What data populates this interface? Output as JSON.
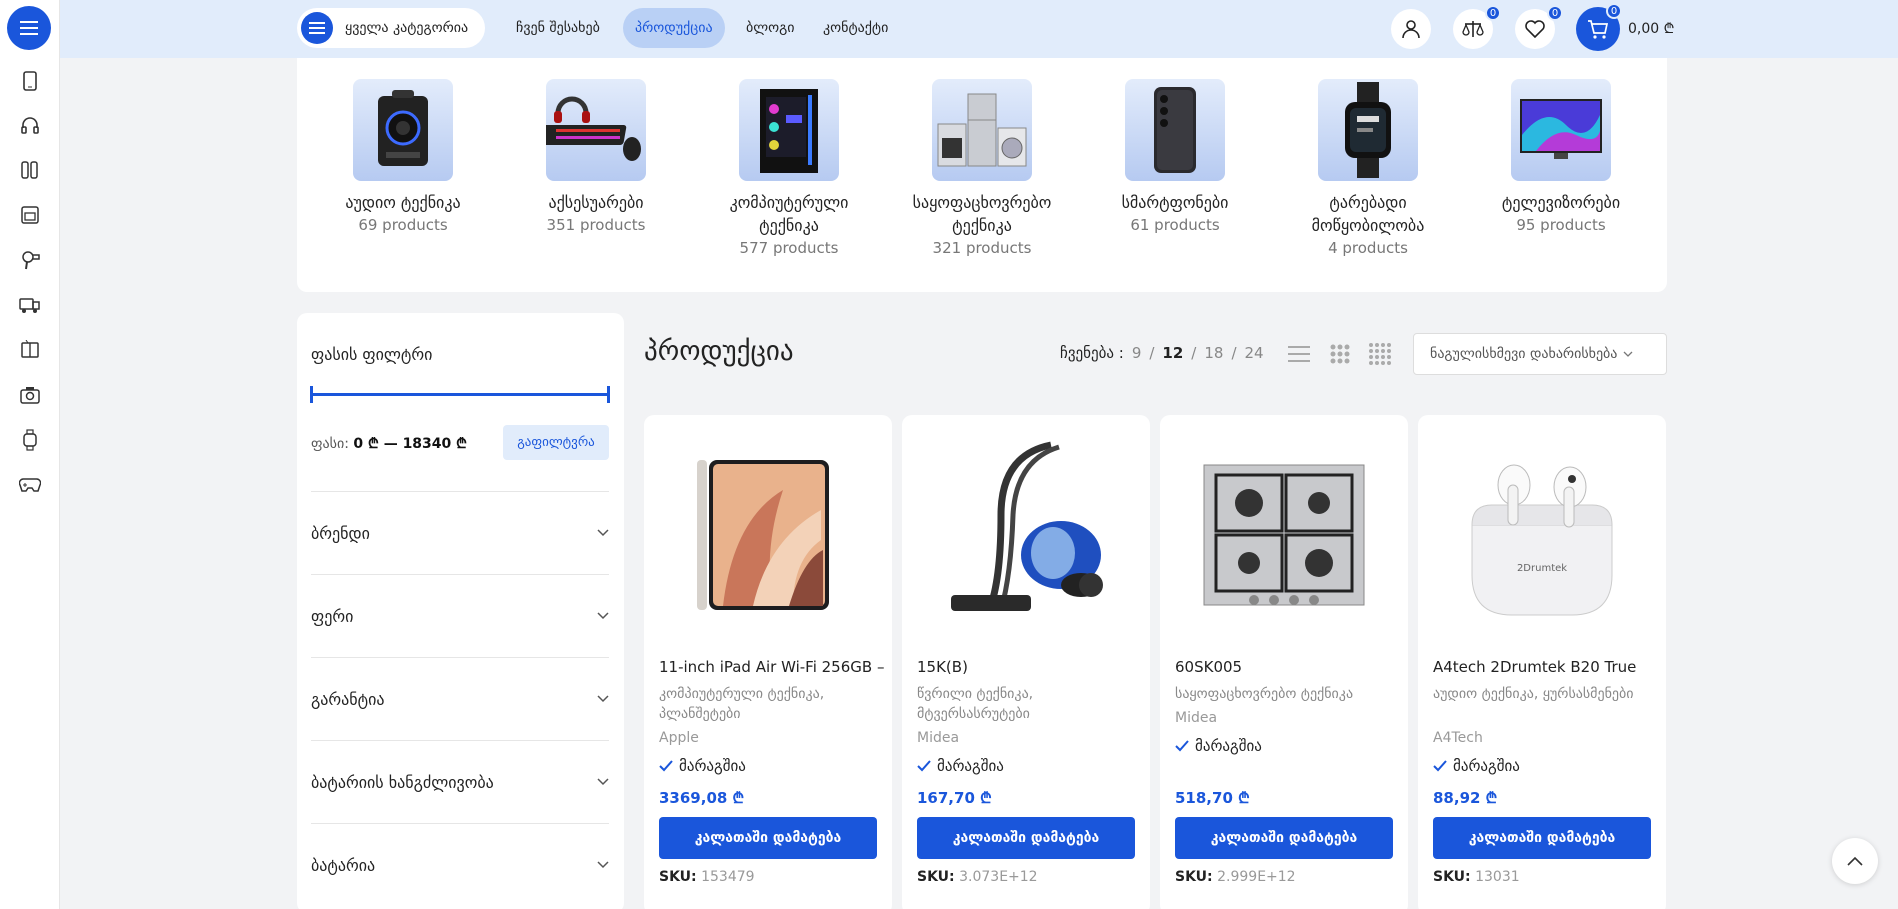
{
  "header": {
    "all_categories": "ყველა კატეგორია",
    "nav": [
      "ჩვენ შესახებ",
      "პროდუქცია",
      "ბლოგი",
      "კონტაქტი"
    ],
    "active_nav": "პროდუქცია",
    "compare_count": "0",
    "wishlist_count": "0",
    "cart_count": "0",
    "cart_total": "0,00 ₾"
  },
  "rail_icons": [
    "phone-icon",
    "headphones-icon",
    "kitchen-tools-icon",
    "oven-icon",
    "hair-dryer-icon",
    "vehicle-icon",
    "fridge-icon",
    "camera-icon",
    "watch-icon",
    "gamepad-icon"
  ],
  "categories": [
    {
      "name": "აუდიო ტექნიკა",
      "count": "69 products",
      "icon": "speaker-icon"
    },
    {
      "name": "აქსესუარები",
      "count": "351 products",
      "icon": "keyboard-icon"
    },
    {
      "name": "კომპიუტერული ტექნიკა",
      "count": "577 products",
      "icon": "pc-case-icon"
    },
    {
      "name": "საყოფაცხოვრებო ტექნიკა",
      "count": "321 products",
      "icon": "appliances-icon"
    },
    {
      "name": "სმარტფონები",
      "count": "61 products",
      "icon": "smartphone-icon"
    },
    {
      "name": "ტარებადი მოწყობილობა",
      "count": "4 products",
      "icon": "smartwatch-icon"
    },
    {
      "name": "ტელევიზორები",
      "count": "95 products",
      "icon": "tv-icon"
    }
  ],
  "filter": {
    "title": "ფასის ფილტრი",
    "price_label": "ფასი:",
    "price_range": "0 ₾ — 18340 ₾",
    "button": "გაფილტვრა",
    "accordions": [
      "ბრენდი",
      "ფერი",
      "გარანტია",
      "ბატარიის ხანგძლივობა",
      "ბატარია"
    ]
  },
  "products_header": {
    "title": "პროდუქცია",
    "show_label": "ჩვენება :",
    "per_page": [
      "9",
      "12",
      "18",
      "24"
    ],
    "per_page_active": "12",
    "sort": "ნაგულისხმევი დახარისხება"
  },
  "products": [
    {
      "title": "11-inch iPad Air Wi-Fi 256GB –",
      "categories": "კომპიუტერული ტექნიკა, პლანშეტები",
      "brand": "Apple",
      "stock": "მარაგშია",
      "price": "3369,08 ₾",
      "button": "კალათაში დამატება",
      "sku_label": "SKU:",
      "sku": "153479",
      "icon": "tablet-icon"
    },
    {
      "title": "15K(B)",
      "categories": "წვრილი ტექნიკა, მტვერსასრუტები",
      "brand": "Midea",
      "stock": "მარაგშია",
      "price": "167,70 ₾",
      "button": "კალათაში დამატება",
      "sku_label": "SKU:",
      "sku": "3.073E+12",
      "icon": "vacuum-icon"
    },
    {
      "title": "60SK005",
      "categories": "საყოფაცხოვრებო ტექნიკა",
      "brand": "Midea",
      "stock": "მარაგშია",
      "price": "518,70 ₾",
      "button": "კალათაში დამატება",
      "sku_label": "SKU:",
      "sku": "2.999E+12",
      "icon": "gas-hob-icon"
    },
    {
      "title": "A4tech 2Drumtek B20 True",
      "categories": "აუდიო ტექნიკა, ყურსასმენები",
      "brand": "A4Tech",
      "stock": "მარაგშია",
      "price": "88,92 ₾",
      "button": "კალათაში დამატება",
      "sku_label": "SKU:",
      "sku": "13031",
      "icon": "earbuds-icon",
      "logo_text": "2Drumtek"
    }
  ],
  "colors": {
    "accent": "#1a56db",
    "header_bg": "#e1ecfb",
    "page_bg": "#f2f3f5"
  }
}
